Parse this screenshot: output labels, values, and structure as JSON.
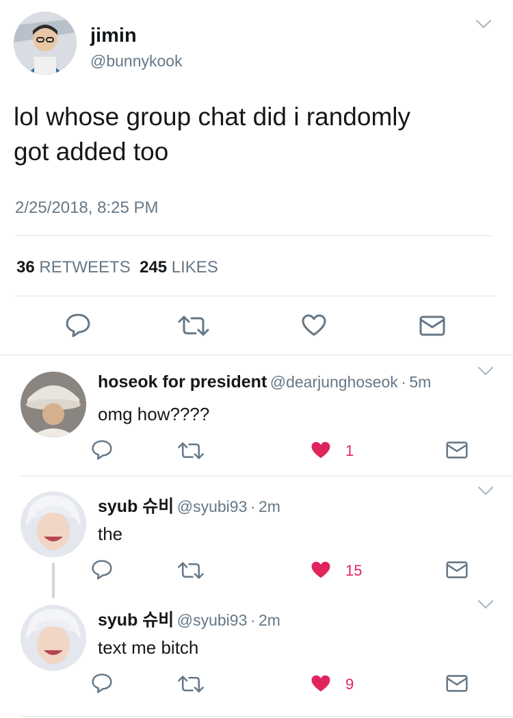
{
  "tweet": {
    "display_name": "jimin",
    "handle": "@bunnykook",
    "text_line1": "lol whose group chat did i randomly",
    "text_line2": "got added too",
    "date": "2/25/2018, 8:25 PM",
    "retweets_count": "36",
    "retweets_label": "RETWEETS",
    "likes_count": "245",
    "likes_label": "LIKES"
  },
  "replies": [
    {
      "display_name": "hoseok for president",
      "handle": "@dearjunghoseok",
      "separator": "·",
      "time": "5m",
      "text": "omg how????",
      "like_count": "1"
    },
    {
      "display_name": "syub 슈비",
      "handle": "@syubi93",
      "separator": "·",
      "time": "2m",
      "text": "the",
      "like_count": "15"
    },
    {
      "display_name": "syub 슈비",
      "handle": "@syubi93",
      "separator": "·",
      "time": "2m",
      "text": "text me bitch",
      "like_count": "9"
    }
  ],
  "colors": {
    "text": "#14171a",
    "secondary": "#657786",
    "like_red": "#e0245e",
    "divider": "#dfe3e7"
  }
}
